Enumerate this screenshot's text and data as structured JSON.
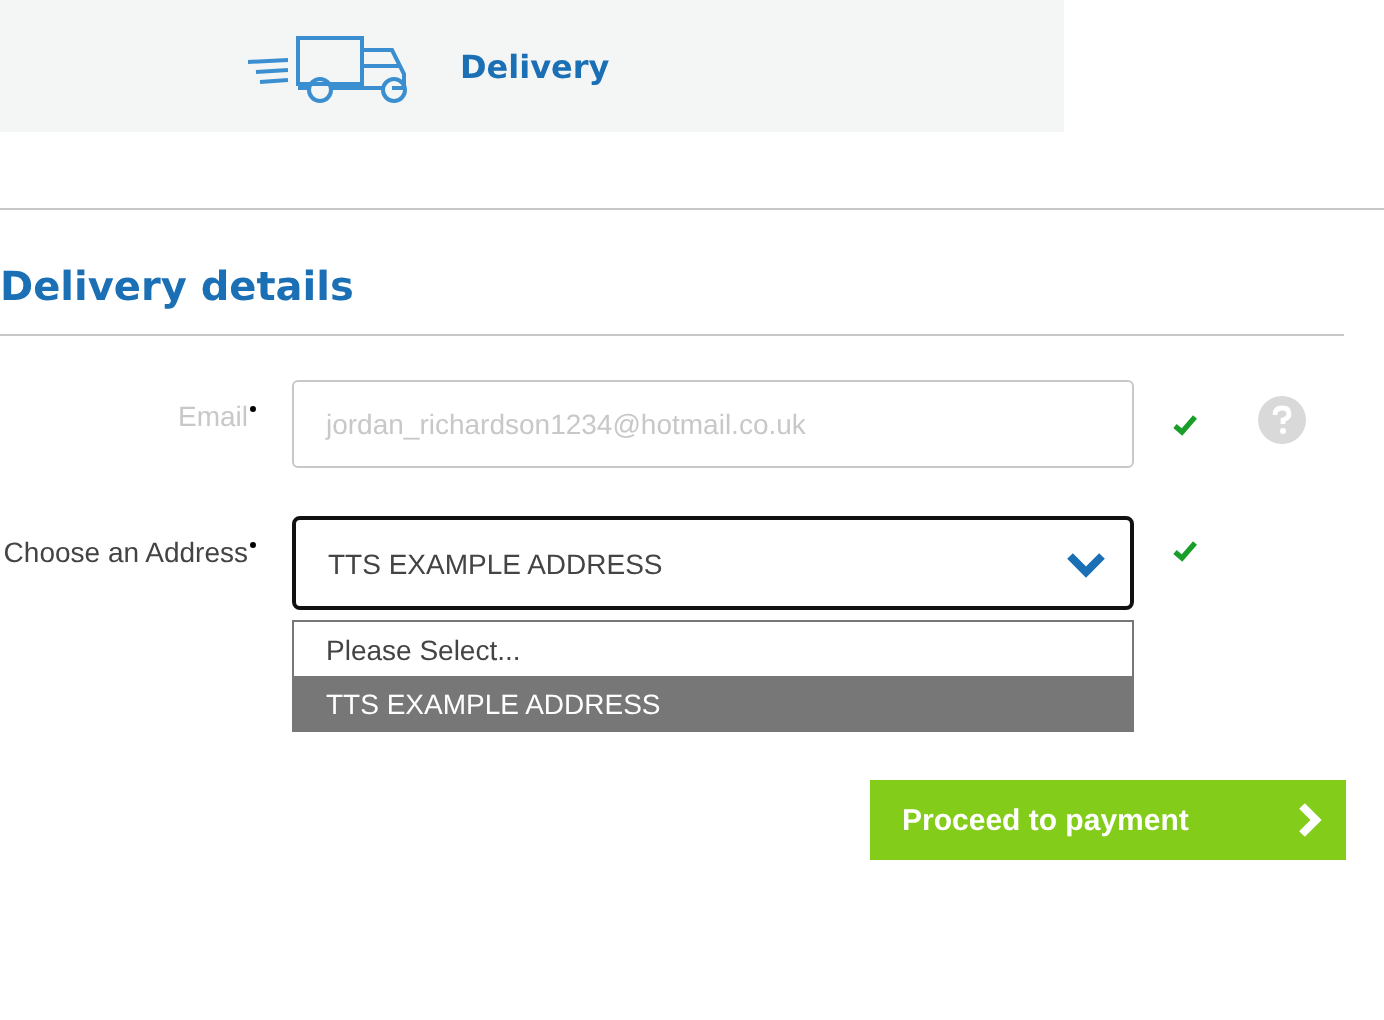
{
  "step": {
    "label": "Delivery"
  },
  "section": {
    "title": "Delivery details"
  },
  "fields": [
    {
      "kind": "text",
      "label": "Email",
      "required": true,
      "disabled": true,
      "value": "jordan_richardson1234@hotmail.co.uk",
      "valid": true,
      "help": true
    },
    {
      "kind": "select",
      "label": "Choose an Address",
      "required": true,
      "disabled": false,
      "value": "TTS EXAMPLE ADDRESS",
      "valid": true,
      "help": false,
      "expanded": true,
      "options": [
        {
          "label": "Please Select...",
          "selected": false
        },
        {
          "label": "TTS EXAMPLE ADDRESS",
          "selected": true
        }
      ]
    }
  ],
  "button": {
    "label": "Proceed to payment"
  }
}
